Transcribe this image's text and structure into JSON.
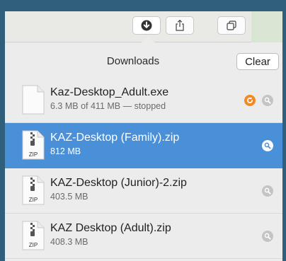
{
  "toolbar": {
    "buttons": [
      {
        "icon": "download-arrow-icon"
      },
      {
        "icon": "share-icon"
      },
      {
        "icon": "tabs-overview-icon"
      }
    ]
  },
  "downloads_popover": {
    "title": "Downloads",
    "clear_label": "Clear",
    "items": [
      {
        "name": "Kaz-Desktop_Adult.exe",
        "meta": "6.3 MB of 411 MB — stopped",
        "file_type": "generic",
        "selected": false,
        "resume": true
      },
      {
        "name": "KAZ-Desktop (Family).zip",
        "meta": "812 MB",
        "file_type": "zip",
        "badge": "ZIP",
        "selected": true,
        "resume": false
      },
      {
        "name": "KAZ-Desktop (Junior)-2.zip",
        "meta": "403.5 MB",
        "file_type": "zip",
        "badge": "ZIP",
        "selected": false,
        "resume": false
      },
      {
        "name": "KAZ Desktop (Adult).zip",
        "meta": "408.3 MB",
        "file_type": "zip",
        "badge": "ZIP",
        "selected": false,
        "resume": false
      }
    ]
  },
  "colors": {
    "selection": "#4a90d9",
    "resume_orange": "#f08a24",
    "frame": "#2f5f7a"
  }
}
